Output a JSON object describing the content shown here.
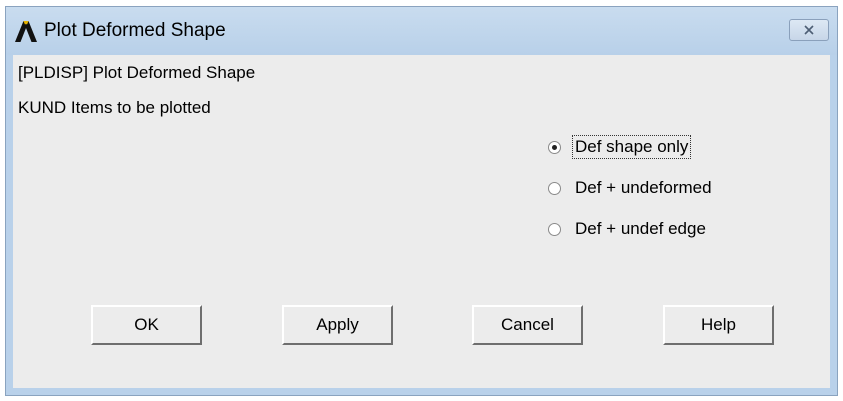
{
  "window": {
    "title": "Plot Deformed Shape"
  },
  "content": {
    "command_line": "[PLDISP]  Plot Deformed Shape",
    "item_line": "KUND   Items to be plotted"
  },
  "options": [
    {
      "label": "Def shape only",
      "checked": true
    },
    {
      "label": "Def + undeformed",
      "checked": false
    },
    {
      "label": "Def + undef edge",
      "checked": false
    }
  ],
  "buttons": {
    "ok": "OK",
    "apply": "Apply",
    "cancel": "Cancel",
    "help": "Help"
  },
  "colors": {
    "title_bar": "#b9d1ea",
    "client_bg": "#ececec"
  },
  "icons": {
    "app": "ansys-logo-icon",
    "close": "close-icon"
  }
}
